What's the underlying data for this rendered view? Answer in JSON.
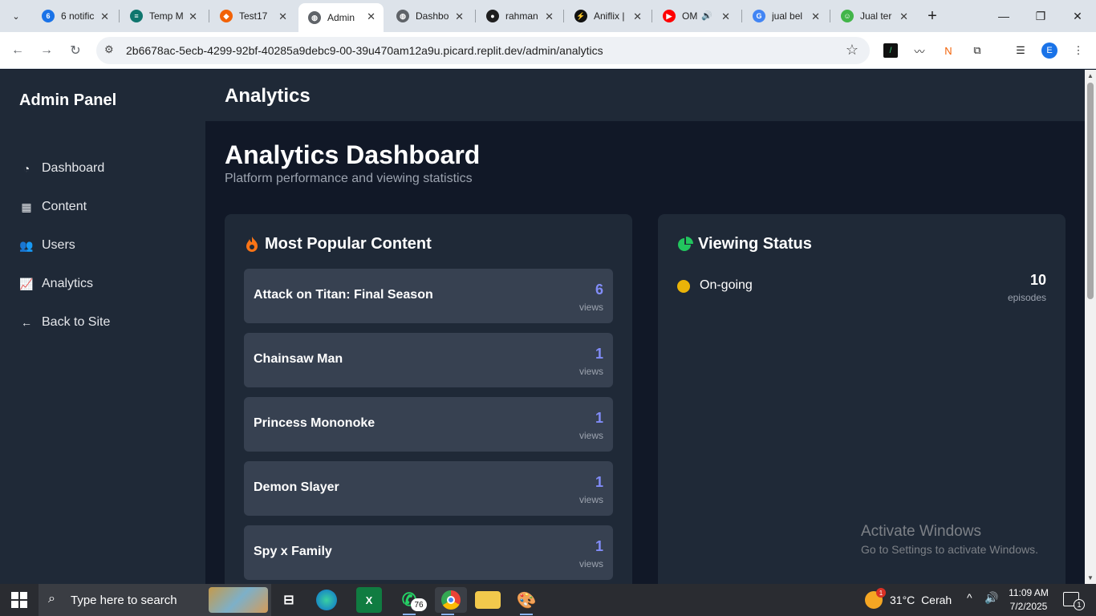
{
  "browser": {
    "tabs": [
      {
        "title": "6 notific",
        "favicon": "notification-icon",
        "color": "#1a73e8",
        "glyph": "6"
      },
      {
        "title": "Temp M",
        "favicon": "temp-mail-icon",
        "color": "#0f766e",
        "glyph": "≡"
      },
      {
        "title": "Test17",
        "favicon": "replit-icon",
        "color": "#f26207",
        "glyph": "◆"
      },
      {
        "title": "Admin",
        "favicon": "globe-icon",
        "color": "#5f6368",
        "glyph": "◍",
        "active": true
      },
      {
        "title": "Dashbo",
        "favicon": "globe-icon",
        "color": "#5f6368",
        "glyph": "◍"
      },
      {
        "title": "rahman",
        "favicon": "github-icon",
        "color": "#1f1f1f",
        "glyph": "●"
      },
      {
        "title": "Aniflix |",
        "favicon": "aniflix-icon",
        "color": "#111111",
        "glyph": "⚡"
      },
      {
        "title": "OM",
        "favicon": "youtube-icon",
        "color": "#ff0000",
        "glyph": "▶",
        "audio": true
      },
      {
        "title": "jual bel",
        "favicon": "google-icon",
        "color": "#4285f4",
        "glyph": "G"
      },
      {
        "title": "Jual ter",
        "favicon": "tokopedia-icon",
        "color": "#42b549",
        "glyph": "☺"
      }
    ],
    "url": "2b6678ac-5ecb-4299-92bf-40285a9debc9-00-39u470am12a9u.picard.replit.dev/admin/analytics",
    "profile_initial": "E"
  },
  "sidebar": {
    "brand": "Admin Panel",
    "items": [
      {
        "label": "Dashboard",
        "icon": "tachometer-icon"
      },
      {
        "label": "Content",
        "icon": "film-icon"
      },
      {
        "label": "Users",
        "icon": "users-icon"
      },
      {
        "label": "Analytics",
        "icon": "chart-line-icon"
      },
      {
        "label": "Back to Site",
        "icon": "arrow-left-icon"
      }
    ]
  },
  "header": {
    "title": "Analytics"
  },
  "main": {
    "title": "Analytics Dashboard",
    "subtitle": "Platform performance and viewing statistics",
    "popular": {
      "title": "Most Popular Content",
      "icon": "fire-icon",
      "items": [
        {
          "name": "Attack on Titan: Final Season",
          "count": "6",
          "unit": "views"
        },
        {
          "name": "Chainsaw Man",
          "count": "1",
          "unit": "views"
        },
        {
          "name": "Princess Mononoke",
          "count": "1",
          "unit": "views"
        },
        {
          "name": "Demon Slayer",
          "count": "1",
          "unit": "views"
        },
        {
          "name": "Spy x Family",
          "count": "1",
          "unit": "views"
        }
      ]
    },
    "status": {
      "title": "Viewing Status",
      "icon": "pie-chart-icon",
      "items": [
        {
          "name": "On-going",
          "count": "10",
          "unit": "episodes",
          "color": "#eab308"
        }
      ]
    }
  },
  "watermark": {
    "line1": "Activate Windows",
    "line2": "Go to Settings to activate Windows."
  },
  "taskbar": {
    "search_placeholder": "Type here to search",
    "whatsapp_badge": "76",
    "weather": {
      "temp": "31°C",
      "condition": "Cerah",
      "badge": "1"
    },
    "time": "11:09 AM",
    "date": "7/2/2025",
    "notifications": "1"
  }
}
